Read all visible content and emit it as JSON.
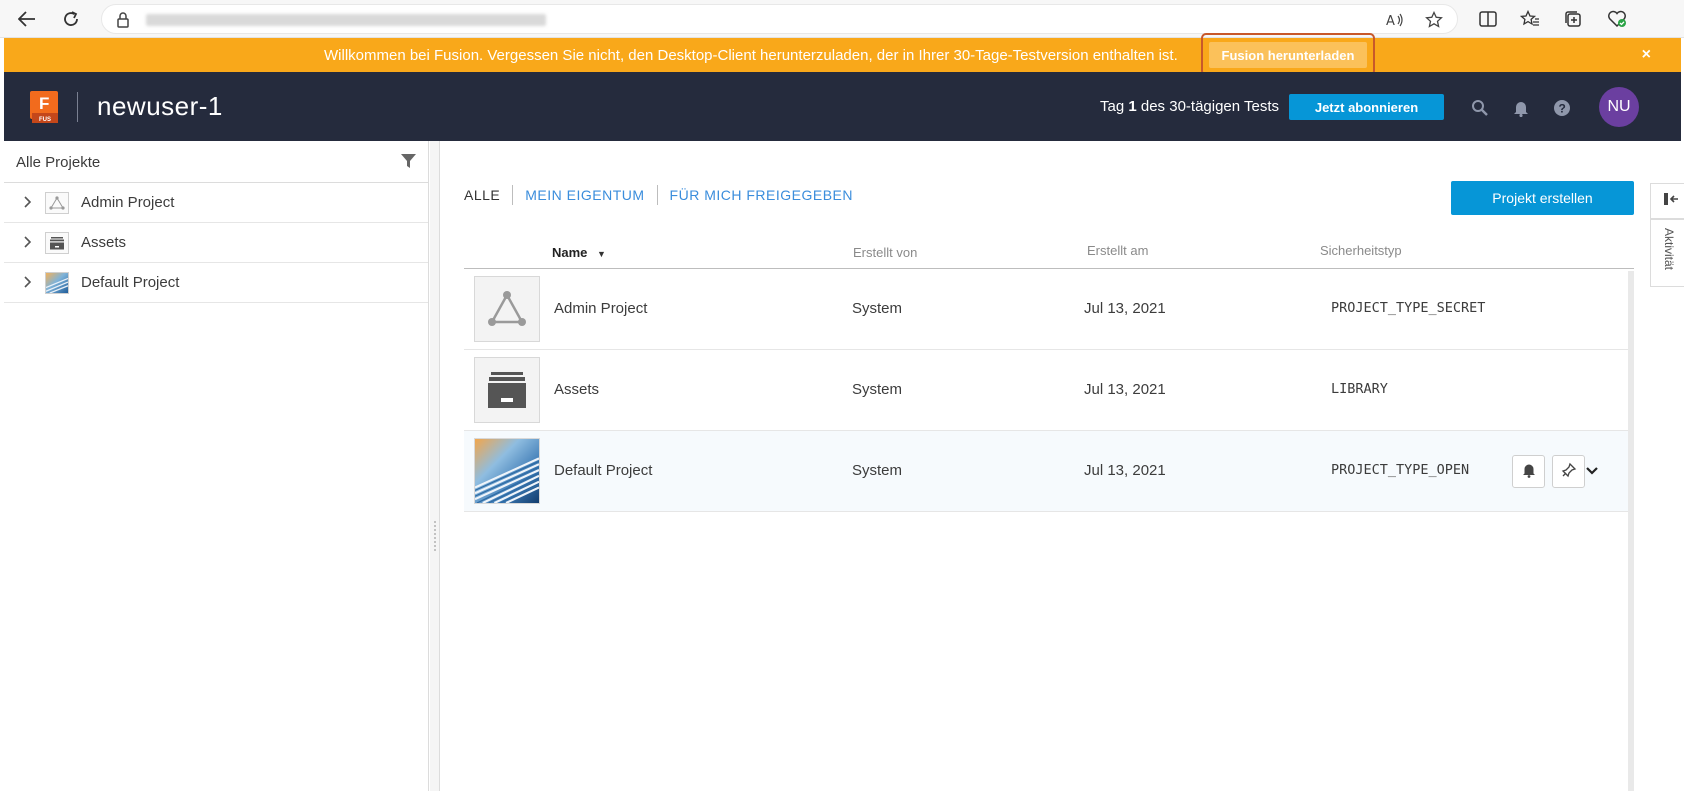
{
  "browser": {
    "icons": [
      "back-icon",
      "refresh-icon",
      "lock-icon",
      "read-aloud-icon",
      "favorite-icon",
      "split-screen-icon",
      "favorites-icon",
      "collections-icon",
      "performance-icon"
    ]
  },
  "banner": {
    "message": "Willkommen bei Fusion. Vergessen Sie nicht, den Desktop-Client herunterzuladen, der in Ihrer 30-Tage-Testversion enthalten ist.",
    "download_label": "Fusion herunterladen",
    "close_label": "×",
    "color": "#f9a81a"
  },
  "header": {
    "logo_letter": "F",
    "logo_sub": "FUS",
    "title": "newuser-1",
    "trial_prefix": "Tag",
    "trial_day": "1",
    "trial_suffix": "des 30-tägigen Tests",
    "subscribe_label": "Jetzt abonnieren",
    "avatar_initials": "NU",
    "avatar_color": "#6b3fa0",
    "accent": "#0696d7"
  },
  "sidebar": {
    "title": "Alle Projekte",
    "items": [
      {
        "label": "Admin Project",
        "icon": "triangle-network-icon"
      },
      {
        "label": "Assets",
        "icon": "archive-box-icon"
      },
      {
        "label": "Default Project",
        "icon": "image-thumbnail-icon"
      }
    ]
  },
  "main": {
    "tabs": [
      {
        "label": "ALLE",
        "active": true
      },
      {
        "label": "MEIN EIGENTUM",
        "active": false
      },
      {
        "label": "FÜR MICH FREIGEGEBEN",
        "active": false
      }
    ],
    "create_label": "Projekt erstellen",
    "columns": {
      "name": "Name",
      "sort": "▼",
      "created_by": "Erstellt von",
      "created_on": "Erstellt am",
      "security": "Sicherheitstyp"
    },
    "rows": [
      {
        "name": "Admin Project",
        "created_by": "System",
        "created_on": "Jul 13, 2021",
        "security": "PROJECT_TYPE_SECRET"
      },
      {
        "name": "Assets",
        "created_by": "System",
        "created_on": "Jul 13, 2021",
        "security": "LIBRARY"
      },
      {
        "name": "Default Project",
        "created_by": "System",
        "created_on": "Jul 13, 2021",
        "security": "PROJECT_TYPE_OPEN"
      }
    ]
  },
  "right_rail": {
    "activity_label": "Aktivität"
  }
}
